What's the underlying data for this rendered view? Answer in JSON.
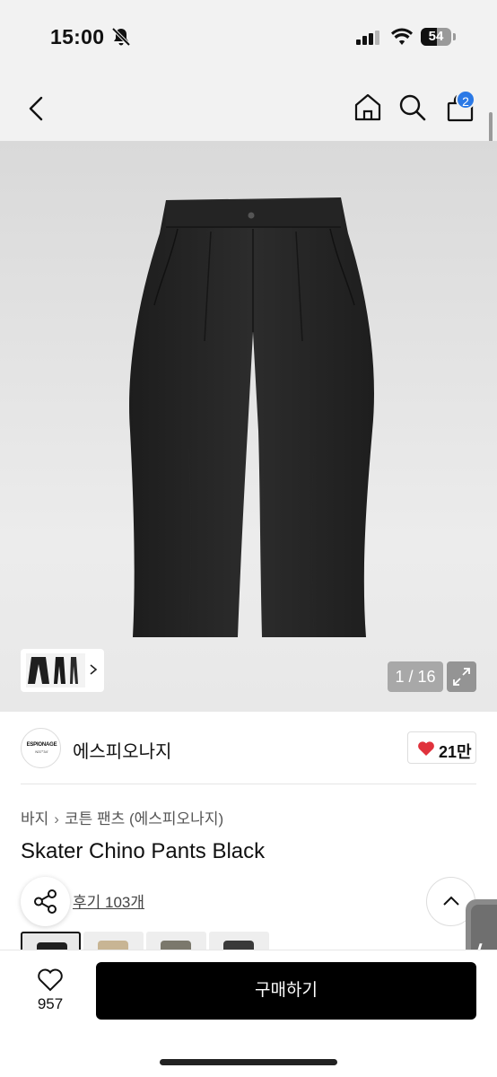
{
  "status_bar": {
    "time": "15:00",
    "battery": "54",
    "battery_level": 0.54
  },
  "header": {
    "cart_count": "2"
  },
  "gallery": {
    "counter": "1 / 16"
  },
  "brand": {
    "logo_text": "ESPIONAGE",
    "logo_sub": "N37°34'",
    "name": "에스피오나지",
    "likes": "21만"
  },
  "breadcrumb": {
    "level1": "바지",
    "level2": "코튼 팬츠 (에스피오나지)"
  },
  "product": {
    "title": "Skater Chino Pants Black",
    "reviews": "후기 103개"
  },
  "swatches": [
    {
      "color": "#1f1f1f",
      "selected": true
    },
    {
      "color": "#c8b594",
      "selected": false
    },
    {
      "color": "#7b786c",
      "selected": false
    },
    {
      "color": "#3a3a3a",
      "selected": false
    }
  ],
  "bottom": {
    "wish_count": "957",
    "buy_label": "구매하기"
  },
  "colors": {
    "accent": "#2b79e6",
    "like_heart": "#e0323c",
    "buy_bg": "#000000"
  }
}
